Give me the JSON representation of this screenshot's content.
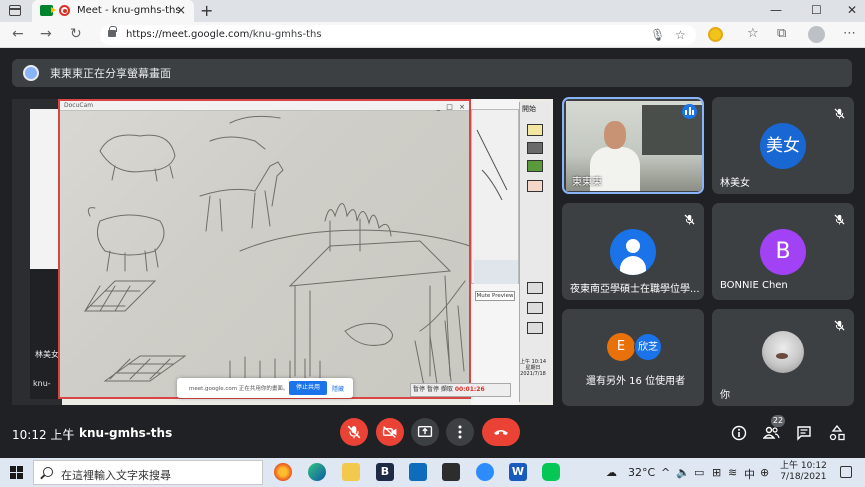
{
  "browser": {
    "tab_title": "Meet - knu-gmhs-ths",
    "tab_close": "×",
    "new_tab": "+",
    "url_host": "https://meet.google.com",
    "url_path": "/knu-gmhs-ths",
    "window_controls": [
      "—",
      "☐",
      "✕"
    ]
  },
  "share_notice": {
    "text": "東東東正在分享螢幕畫面"
  },
  "shared_screen": {
    "doccam_title": "DocuCam",
    "background_meet_name": "林美女",
    "background_meet_code": "knu-",
    "mute_preview": "Mute Preview",
    "toolbar_label": "開始",
    "rec_pause": "暫停",
    "rec_stop": "暫停",
    "rec_snapshot": "擷取",
    "rec_time": "00:01:26",
    "stop_popup_text": "meet.google.com 正在共用你的畫面。",
    "stop_popup_button": "停止共用",
    "stop_popup_hide": "隱藏",
    "taskbar_clock_time": "上午 10:14",
    "taskbar_clock_day": "星期日",
    "taskbar_clock_date": "2021/7/18"
  },
  "participants": [
    {
      "name": "東東東",
      "type": "camera",
      "speaking": true
    },
    {
      "name": "林美女",
      "avatar_text": "美女",
      "avatar_color": "#1967d2",
      "muted": true
    },
    {
      "name": "夜東南亞學碩士在職學位學...",
      "type": "generic",
      "muted": true
    },
    {
      "name": "BONNIE Chen",
      "avatar_text": "B",
      "avatar_color": "#a142f4",
      "muted": true
    },
    {
      "name": "還有另外 16 位使用者",
      "type": "group",
      "group_avatars": [
        {
          "text": "E",
          "color": "#e8710a"
        },
        {
          "text": "欣芝",
          "color": "#1a73e8"
        }
      ]
    },
    {
      "name": "你",
      "type": "photo",
      "muted": true
    }
  ],
  "controls": {
    "time": "10:12 上午",
    "meeting_code": "knu-gmhs-ths",
    "participants_count": "22",
    "colors": {
      "danger": "#ea4335",
      "bar_bg": "#202124",
      "tile_bg": "#3c4043"
    }
  },
  "taskbar": {
    "search_placeholder": "在這裡輸入文字來搜尋",
    "temperature": "32°C",
    "ime": "中",
    "clock_time": "上午 10:12",
    "clock_date": "7/18/2021"
  }
}
